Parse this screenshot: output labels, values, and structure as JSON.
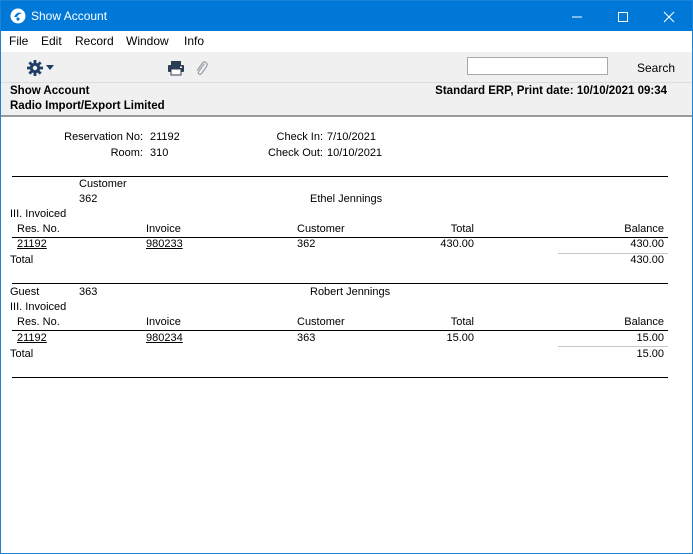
{
  "window": {
    "title": "Show Account",
    "minimize": "—",
    "maximize": "☐",
    "close": "✕"
  },
  "menu": {
    "items": [
      "File",
      "Edit",
      "Record",
      "Window",
      "Info"
    ]
  },
  "toolbar": {
    "search_placeholder": "",
    "search_label": "Search",
    "gear_icon": "gear-icon",
    "print_icon": "printer-icon",
    "attach_icon": "paperclip-icon"
  },
  "header": {
    "report_name": "Show Account",
    "company": "Radio Import/Export Limited",
    "system_info": "Standard ERP, Print date: 10/10/2021 09:34"
  },
  "reservation": {
    "res_no_label": "Reservation No:",
    "res_no": "21192",
    "room_label": "Room:",
    "room": "310",
    "check_in_label": "Check In:",
    "check_in": "7/10/2021",
    "check_out_label": "Check Out:",
    "check_out": "10/10/2021"
  },
  "columns": {
    "res_no": "Res. No.",
    "invoice": "Invoice",
    "customer": "Customer",
    "total": "Total",
    "balance": "Balance"
  },
  "sections": [
    {
      "party_label": "Customer",
      "party_code": "362",
      "party_name": "Ethel Jennings",
      "group": "III. Invoiced",
      "row": {
        "res_no": "21192",
        "invoice": "980233",
        "customer": "362",
        "total": "430.00",
        "balance": "430.00"
      },
      "total_label": "Total",
      "total_balance": "430.00"
    },
    {
      "party_label": "Guest",
      "party_code": "363",
      "party_name": "Robert Jennings",
      "group": "III. Invoiced",
      "row": {
        "res_no": "21192",
        "invoice": "980234",
        "customer": "363",
        "total": "15.00",
        "balance": "15.00"
      },
      "total_label": "Total",
      "total_balance": "15.00"
    }
  ]
}
